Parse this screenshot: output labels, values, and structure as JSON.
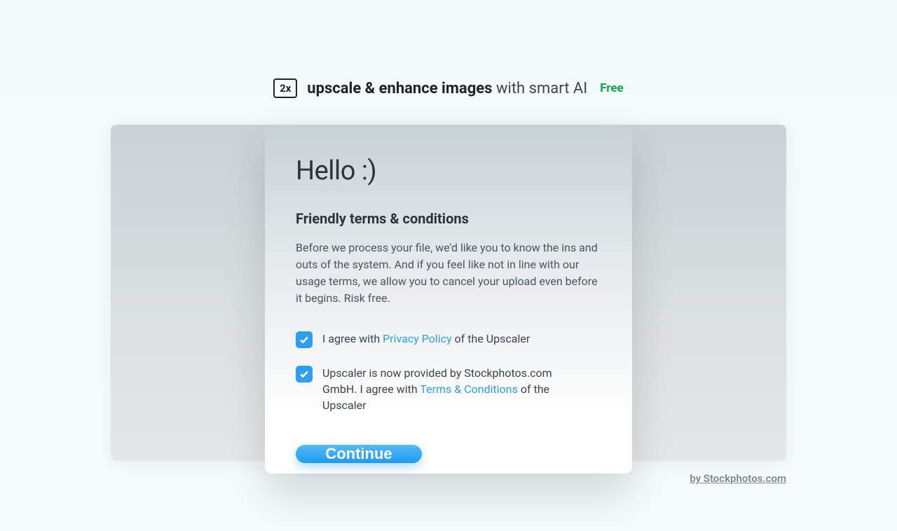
{
  "header": {
    "logo_text": "2x",
    "title_bold": "upscale & enhance images",
    "title_light": "with smart AI",
    "free_label": "Free"
  },
  "modal": {
    "title": "Hello :)",
    "subtitle": "Friendly terms & conditions",
    "body": "Before we process your file, we'd like you to know the ins and outs of the system. And if you feel like not in line with our usage terms, we allow you to cancel your upload even before it begins. Risk free.",
    "check1_pre": "I agree with ",
    "check1_link": "Privacy Policy",
    "check1_post": " of the Upscaler",
    "check2_pre": "Upscaler is now provided by Stockphotos.com GmbH. I agree with ",
    "check2_link": "Terms & Conditions",
    "check2_post": " of the Upscaler",
    "continue_label": "Continue"
  },
  "footer": {
    "credit": "by Stockphotos.com"
  }
}
